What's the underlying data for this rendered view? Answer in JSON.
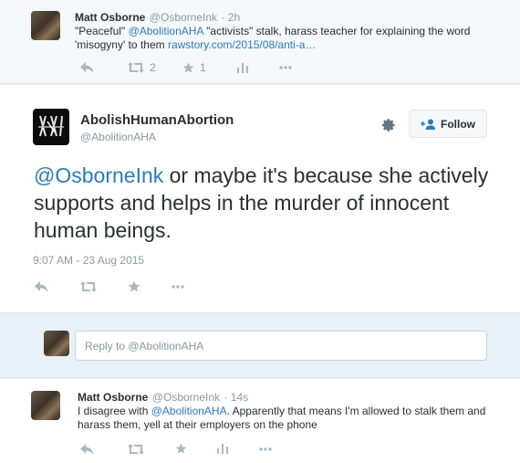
{
  "parent_tweet": {
    "author_name": "Matt Osborne",
    "author_handle": "@OsborneInk",
    "time": "· 2h",
    "text_1": "\"Peaceful\" ",
    "mention": "@AbolitionAHA",
    "text_2": " \"activists\" stalk, harass teacher for explaining the word 'misogyny' to them ",
    "link": "rawstory.com/2015/08/anti-a…",
    "retweet_count": "2",
    "favorite_count": "1"
  },
  "focus_tweet": {
    "author_name": "AbolishHumanAbortion",
    "author_handle": "@AbolitionAHA",
    "follow_label": "Follow",
    "mention": "@OsborneInk",
    "text": " or maybe it's because she actively supports and helps in the murder of innocent human beings.",
    "timestamp": "9:07 AM - 23 Aug 2015"
  },
  "reply_box": {
    "placeholder": "Reply to @AbolitionAHA"
  },
  "reply_tweet": {
    "author_name": "Matt Osborne",
    "author_handle": "@OsborneInk",
    "time": "· 14s",
    "text_1": "I disagree with ",
    "mention": "@AbolitionAHA",
    "text_2": ". Apparently that means I'm allowed to stalk them and harass them, yell at their employers on the phone"
  },
  "colors": {
    "link": "#2b7bb9",
    "muted": "#8899a6",
    "icon": "#aab8c2"
  }
}
